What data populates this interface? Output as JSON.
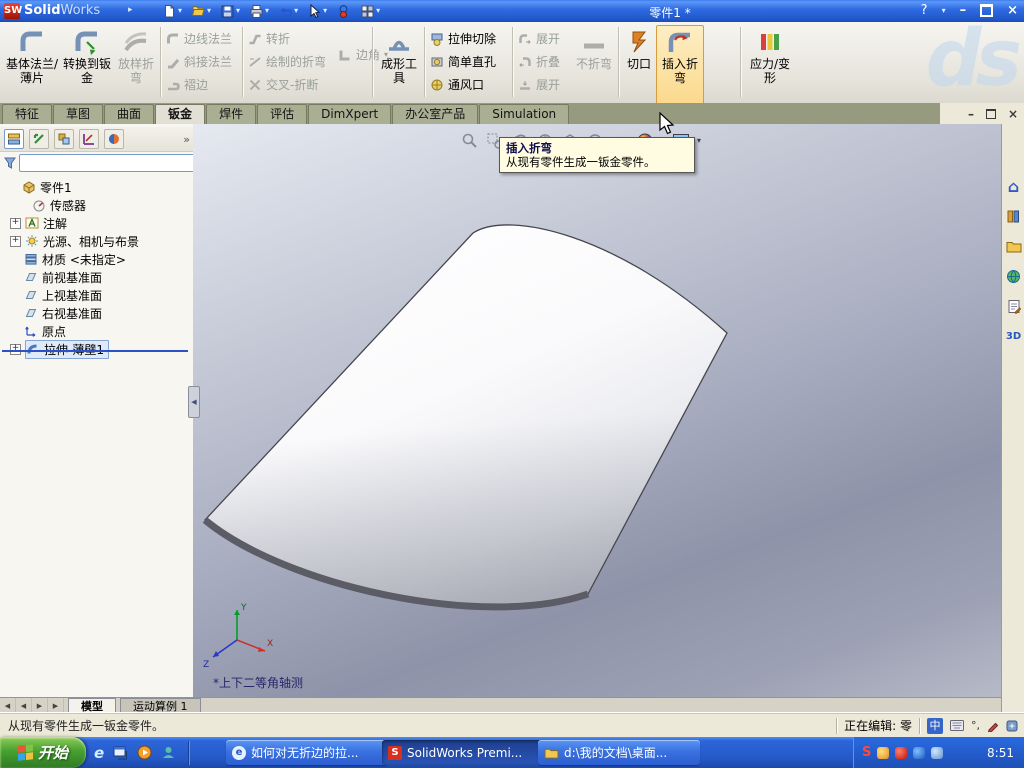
{
  "icons": {
    "plus": "+",
    "dropdown": "▾",
    "chevrons": "»",
    "menu_arrow": "▸",
    "minimize": "–",
    "close": "×",
    "help": "?",
    "first": "◀",
    "prev": "◀",
    "next": "▶",
    "last": "▶",
    "home": "⌂",
    "ie": "e",
    "threed": "3D",
    "ime": "中",
    "degree": "°,"
  },
  "titlebar": {
    "app_bold": "Solid",
    "app_light": "Works",
    "doc_title": "零件1 *"
  },
  "ribbon": {
    "base_flange": "基体法兰/薄片",
    "convert": "转换到钣金",
    "lofted_bend": "放样折弯",
    "edge_flange": "边线法兰",
    "miter_flange": "斜接法兰",
    "hem": "褶边",
    "jog": "转折",
    "sketched_bend": "绘制的折弯",
    "cross_break": "交叉-折断",
    "corner": "边角",
    "forming_tool": "成形工具",
    "extruded_cut": "拉伸切除",
    "simple_hole": "简单直孔",
    "vent": "通风口",
    "unfold": "展开",
    "fold": "折叠",
    "flatten": "展开",
    "no_bends": "不折弯",
    "rip": "切口",
    "insert_bends": "插入折弯",
    "stress": "应力/变形",
    "watermark": "ds"
  },
  "tabs": [
    {
      "label": "特征"
    },
    {
      "label": "草图"
    },
    {
      "label": "曲面"
    },
    {
      "label": "钣金"
    },
    {
      "label": "焊件"
    },
    {
      "label": "评估"
    },
    {
      "label": "DimXpert"
    },
    {
      "label": "办公室产品"
    },
    {
      "label": "Simulation"
    }
  ],
  "tooltip": {
    "title": "插入折弯",
    "body": "从现有零件生成一钣金零件。"
  },
  "feature_tree": {
    "root": "零件1",
    "items": [
      {
        "label": "传感器"
      },
      {
        "label": "注解"
      },
      {
        "label": "光源、相机与布景"
      },
      {
        "label": "材质 <未指定>"
      },
      {
        "label": "前视基准面"
      },
      {
        "label": "上视基准面"
      },
      {
        "label": "右视基准面"
      },
      {
        "label": "原点"
      },
      {
        "label": "拉伸-薄壁1"
      }
    ]
  },
  "viewport": {
    "view_label": "*上下二等角轴测",
    "axis_x": "X",
    "axis_y": "Y",
    "axis_z": "Z"
  },
  "doc_tabs": {
    "model": "模型",
    "motion": "运动算例 1"
  },
  "status": {
    "message": "从现有零件生成一钣金零件。",
    "editing": "正在编辑: 零"
  },
  "taskbar": {
    "start": "开始",
    "windows": [
      {
        "label": "如何对无折边的拉..."
      },
      {
        "label": "SolidWorks Premi..."
      },
      {
        "label": "d:\\我的文档\\桌面..."
      }
    ],
    "tray_s": "S",
    "time": "8:51"
  }
}
